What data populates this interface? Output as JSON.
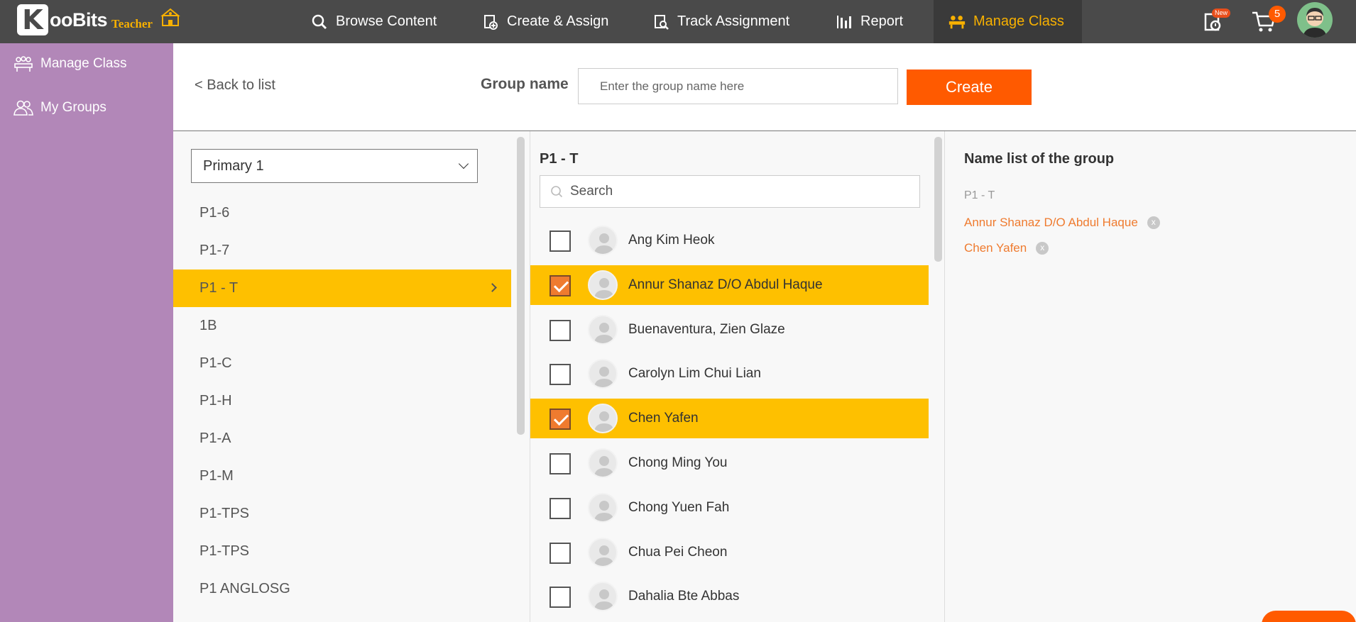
{
  "app": {
    "logo_letter": "K",
    "logo_name": "ooBits",
    "logo_sub": "Teacher"
  },
  "nav": [
    {
      "label": "Browse Content",
      "icon": "search-icon"
    },
    {
      "label": "Create & Assign",
      "icon": "create-assign-icon"
    },
    {
      "label": "Track Assignment",
      "icon": "track-icon"
    },
    {
      "label": "Report",
      "icon": "bar-chart-icon"
    },
    {
      "label": "Manage Class",
      "icon": "manage-class-icon",
      "active": true
    }
  ],
  "topright": {
    "new_badge": "New",
    "cart_count": "5"
  },
  "sidebar": {
    "items": [
      {
        "label": "Manage Class",
        "icon": "class-icon"
      },
      {
        "label": "My Groups",
        "icon": "groups-icon"
      }
    ]
  },
  "header": {
    "back": "< Back to list",
    "group_label": "Group name",
    "group_placeholder": "Enter the group name here",
    "create": "Create"
  },
  "classes": {
    "selected_level": "Primary 1",
    "items": [
      "P1-6",
      "P1-7",
      "P1 - T",
      "1B",
      "P1-C",
      "P1-H",
      "P1-A",
      "P1-M",
      "P1-TPS",
      "P1-TPS",
      "P1 ANGLOSG"
    ],
    "active_index": 2
  },
  "students": {
    "class_title": "P1 - T",
    "search_placeholder": "Search",
    "items": [
      {
        "name": "Ang Kim Heok",
        "checked": false
      },
      {
        "name": "Annur Shanaz D/O Abdul Haque",
        "checked": true
      },
      {
        "name": "Buenaventura, Zien Glaze",
        "checked": false
      },
      {
        "name": "Carolyn Lim Chui Lian",
        "checked": false
      },
      {
        "name": "Chen Yafen",
        "checked": true
      },
      {
        "name": "Chong Ming You",
        "checked": false
      },
      {
        "name": "Chong Yuen Fah",
        "checked": false
      },
      {
        "name": "Chua Pei Cheon",
        "checked": false
      },
      {
        "name": "Dahalia Bte Abbas",
        "checked": false
      }
    ]
  },
  "group": {
    "title": "Name list of the group",
    "class_label": "P1 - T",
    "members": [
      "Annur Shanaz D/O Abdul Haque",
      "Chen Yafen"
    ],
    "remove_glyph": "x"
  },
  "colors": {
    "accent": "#ff5a00",
    "highlight": "#fec000",
    "sidebar": "#b287b8",
    "topbar": "#4a4a4a",
    "member_text": "#ef7b2f"
  }
}
